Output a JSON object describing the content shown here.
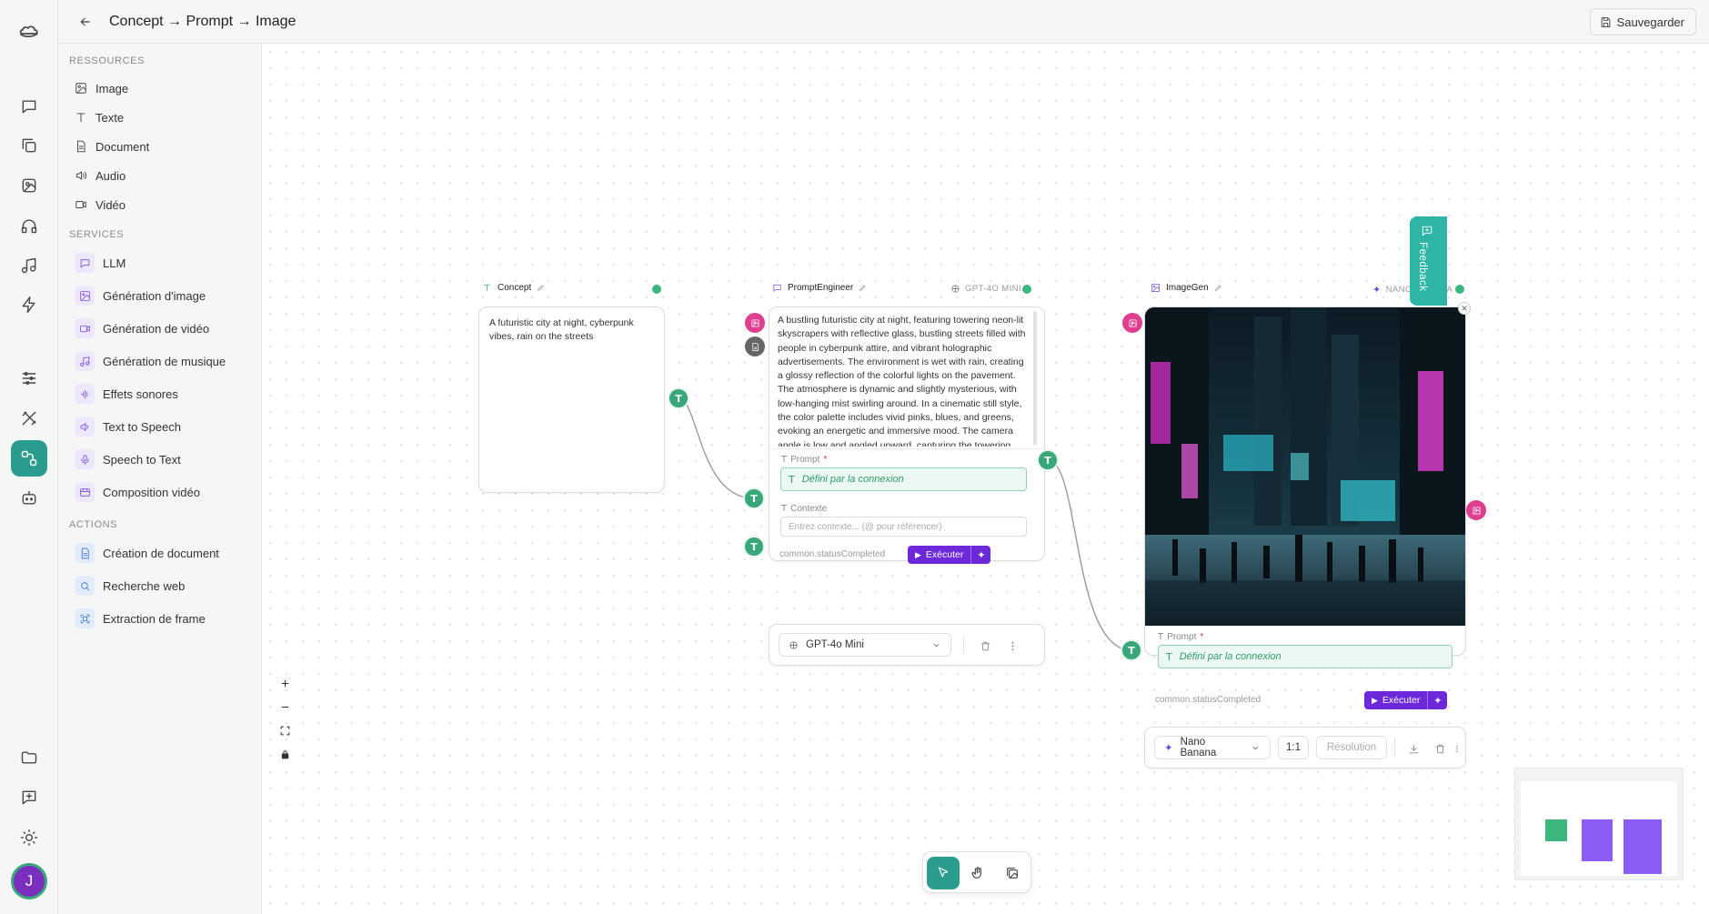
{
  "app": {
    "logo": "cloud-logo"
  },
  "topbar": {
    "title": "Concept → Prompt → Image",
    "save_label": "Sauvegarder"
  },
  "rail": {
    "items": [
      "chat-icon",
      "copy-icon",
      "image-gen-icon",
      "headphones-icon",
      "music-icon",
      "lightning-icon",
      "sliders-icon",
      "tools-icon",
      "workflow-icon",
      "bot-icon",
      "folder-icon",
      "message-plus-icon",
      "sun-icon"
    ],
    "active": "workflow-icon",
    "avatar_letter": "J"
  },
  "panel": {
    "sections": {
      "resources": "RESSOURCES",
      "services": "SERVICES",
      "actions": "ACTIONS"
    },
    "resources": [
      "Image",
      "Texte",
      "Document",
      "Audio",
      "Vidéo"
    ],
    "services": [
      "LLM",
      "Génération d'image",
      "Génération de vidéo",
      "Génération de musique",
      "Effets sonores",
      "Text to Speech",
      "Speech to Text",
      "Composition vidéo"
    ],
    "actions": [
      "Création de document",
      "Recherche web",
      "Extraction de frame"
    ]
  },
  "nodes": {
    "concept": {
      "title": "Concept",
      "text": "A futuristic city at night, cyberpunk vibes, rain on the streets"
    },
    "prompt_engineer": {
      "title": "PromptEngineer",
      "model": "GPT-4O MINI",
      "output": "A bustling futuristic city at night, featuring towering neon-lit skyscrapers with reflective glass, bustling streets filled with people in cyberpunk attire, and vibrant holographic advertisements. The environment is wet with rain, creating a glossy reflection of the colorful lights on the pavement. The atmosphere is dynamic and slightly mysterious, with low-hanging mist swirling around. In a cinematic still style, the color palette includes vivid pinks, blues, and greens, evoking an energetic and immersive mood. The camera angle is low and angled upward, capturing the towering",
      "prompt_label": "Prompt",
      "prompt_value": "Défini par la connexion",
      "context_label": "Contexte",
      "context_placeholder": "Entrez contexte... (@ pour référencer)",
      "status": "common.statusCompleted",
      "run_label": "Exécuter",
      "model_select": "GPT-4o Mini"
    },
    "imagegen": {
      "title": "ImageGen",
      "model": "NANO BANANA",
      "prompt_label": "Prompt",
      "prompt_value": "Défini par la connexion",
      "status": "common.statusCompleted",
      "run_label": "Exécuter",
      "model_select": "Nano Banana",
      "ratio": "1:1",
      "resolution": "Résolution"
    }
  },
  "feedback": {
    "label": "Feedback"
  },
  "colors": {
    "accent": "#2b9d8f",
    "purple": "#6d28d9",
    "connector": "#3aa77a",
    "pink": "#df3f8f"
  }
}
